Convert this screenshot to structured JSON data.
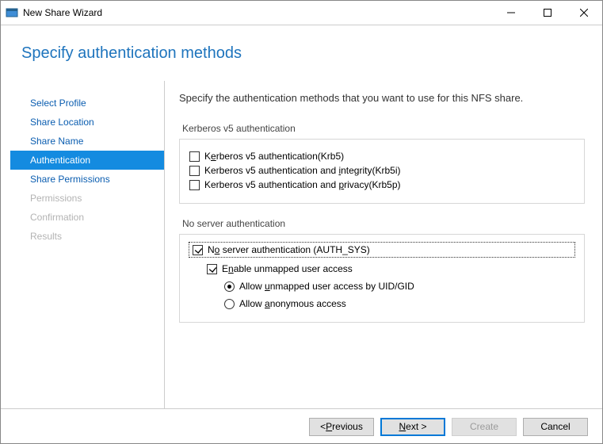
{
  "window": {
    "title": "New Share Wizard"
  },
  "header": {
    "heading": "Specify authentication methods"
  },
  "sidebar": {
    "items": [
      {
        "label": "Select Profile",
        "state": "normal"
      },
      {
        "label": "Share Location",
        "state": "normal"
      },
      {
        "label": "Share Name",
        "state": "normal"
      },
      {
        "label": "Authentication",
        "state": "active"
      },
      {
        "label": "Share Permissions",
        "state": "normal"
      },
      {
        "label": "Permissions",
        "state": "disabled"
      },
      {
        "label": "Confirmation",
        "state": "disabled"
      },
      {
        "label": "Results",
        "state": "disabled"
      }
    ]
  },
  "main": {
    "intro": "Specify the authentication methods that you want to use for this NFS share.",
    "group_kerberos": {
      "title": "Kerberos v5 authentication",
      "krb5": {
        "checked": false,
        "pre": "K",
        "u": "e",
        "post": "rberos v5 authentication(Krb5)"
      },
      "krb5i": {
        "checked": false,
        "pre": "Kerberos v5 authentication and ",
        "u": "i",
        "post": "ntegrity(Krb5i)"
      },
      "krb5p": {
        "checked": false,
        "pre": "Kerberos v5 authentication and ",
        "u": "p",
        "post": "rivacy(Krb5p)"
      }
    },
    "group_noserver": {
      "title": "No server authentication",
      "authsys": {
        "checked": true,
        "pre": "N",
        "u": "o",
        "post": " server authentication (AUTH_SYS)"
      },
      "unmapped": {
        "checked": true,
        "pre": "E",
        "u": "n",
        "post": "able unmapped user access"
      },
      "radio_uidgid": {
        "checked": true,
        "pre": "Allow ",
        "u": "u",
        "post": "nmapped user access by UID/GID"
      },
      "radio_anon": {
        "checked": false,
        "pre": "Allow ",
        "u": "a",
        "post": "nonymous access"
      }
    }
  },
  "footer": {
    "prev": {
      "pre": "< ",
      "u": "P",
      "post": "revious"
    },
    "next": {
      "pre": "",
      "u": "N",
      "post": "ext >"
    },
    "create": "Create",
    "cancel": "Cancel"
  }
}
